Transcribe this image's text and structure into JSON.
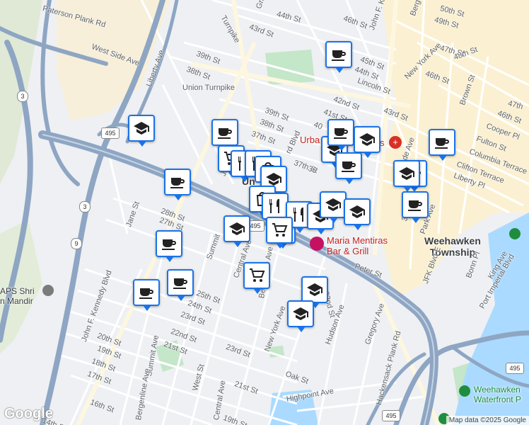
{
  "map": {
    "attribution": "Map data ©2025 Google",
    "logo": "Google",
    "colors": {
      "water": "#aadaff",
      "park": "#c4e6c9",
      "highway": "#8ea6c3",
      "commercial": "#fbf1d2",
      "land": "#eef0f3",
      "pin_border": "#1a73e8",
      "poi_red": "#c5221f"
    }
  },
  "places": [
    {
      "id": "weehawken",
      "text": "Weehawken\nTownship"
    },
    {
      "id": "union",
      "text": "Un"
    }
  ],
  "pois": [
    {
      "id": "maria",
      "text": "Maria Mentiras\nBar & Grill"
    },
    {
      "id": "urban",
      "text": "Urba"
    },
    {
      "id": "urban2",
      "text": "s"
    },
    {
      "id": "shri",
      "text": "APS Shri\nn Mandir"
    },
    {
      "id": "waterfront",
      "text": "Weehawken\nWaterfront P"
    }
  ],
  "shields": [
    {
      "id": "s495a",
      "text": "495"
    },
    {
      "id": "s495b",
      "text": "495"
    },
    {
      "id": "s495c",
      "text": "495"
    },
    {
      "id": "s495d",
      "text": "495"
    },
    {
      "id": "s3a",
      "text": "3"
    },
    {
      "id": "s3b",
      "text": "3"
    },
    {
      "id": "s9",
      "text": "9"
    }
  ],
  "streets": [
    "Paterson Plank Rd",
    "West Side Ave",
    "Union Turnpike",
    "39th St",
    "38th St",
    "Liberty Ave",
    "Grand",
    "44th St",
    "43rd St",
    "Turnpike",
    "46th St",
    "John F. Ke",
    "Berg",
    "50th St",
    "49th St",
    "48th St",
    "47th St",
    "45th St",
    "44th St",
    "New York Ave",
    "46th St",
    "Lincoln St",
    "43rd St",
    "42nd St",
    "41st St",
    "40",
    "39th St",
    "38th St",
    "37th St",
    "37th St",
    "36",
    "Brown St",
    "47th",
    "46th St",
    "Cooper Pl",
    "Fulton St",
    "Columbia Terrace",
    "Clifton Terrace",
    "Liberty Pl",
    "Palisade Ave",
    "Park Ave",
    "37th St",
    "Peter St",
    "JFK Blvd E",
    "Bonn Pl",
    "King Ave",
    "Port Imperial Blvd",
    "Jane St",
    "28th St",
    "27th St",
    "Summit",
    "Central Ave",
    "Bergenline Ave",
    "25th St",
    "24th St",
    "23rd St",
    "22nd St",
    "21st St",
    "20th St",
    "19th St",
    "18th St",
    "17th St",
    "16th St",
    "John F. Kennedy Blvd",
    "Summit Ave",
    "West St",
    "New York Ave",
    "Hudson Ave",
    "Gregory Ave",
    "32nd St",
    "23rd St",
    "Oak St",
    "21st St",
    "Highpoint Ave",
    "Hackensack Plank Rd",
    "Bergenline Ave",
    "Central Ave",
    "19th St",
    "14th St",
    "Johns",
    "rd Blvd"
  ],
  "pins": [
    {
      "type": "coffee"
    },
    {
      "type": "school"
    },
    {
      "type": "coffee"
    },
    {
      "type": "coffee"
    },
    {
      "type": "grocery"
    },
    {
      "type": "restaurant"
    },
    {
      "type": "restaurant"
    },
    {
      "type": "shopping"
    },
    {
      "type": "school"
    },
    {
      "type": "school"
    },
    {
      "type": "coffee"
    },
    {
      "type": "school"
    },
    {
      "type": "coffee"
    },
    {
      "type": "coffee"
    },
    {
      "type": "school"
    },
    {
      "type": "coffee"
    },
    {
      "type": "shopping"
    },
    {
      "type": "restaurant"
    },
    {
      "type": "grocery"
    },
    {
      "type": "restaurant"
    },
    {
      "type": "school"
    },
    {
      "type": "school"
    },
    {
      "type": "school"
    },
    {
      "type": "grocery"
    },
    {
      "type": "school"
    },
    {
      "type": "grocery"
    },
    {
      "type": "coffee"
    },
    {
      "type": "coffee"
    },
    {
      "type": "school"
    },
    {
      "type": "coffee"
    },
    {
      "type": "school"
    },
    {
      "type": "coffee"
    }
  ]
}
